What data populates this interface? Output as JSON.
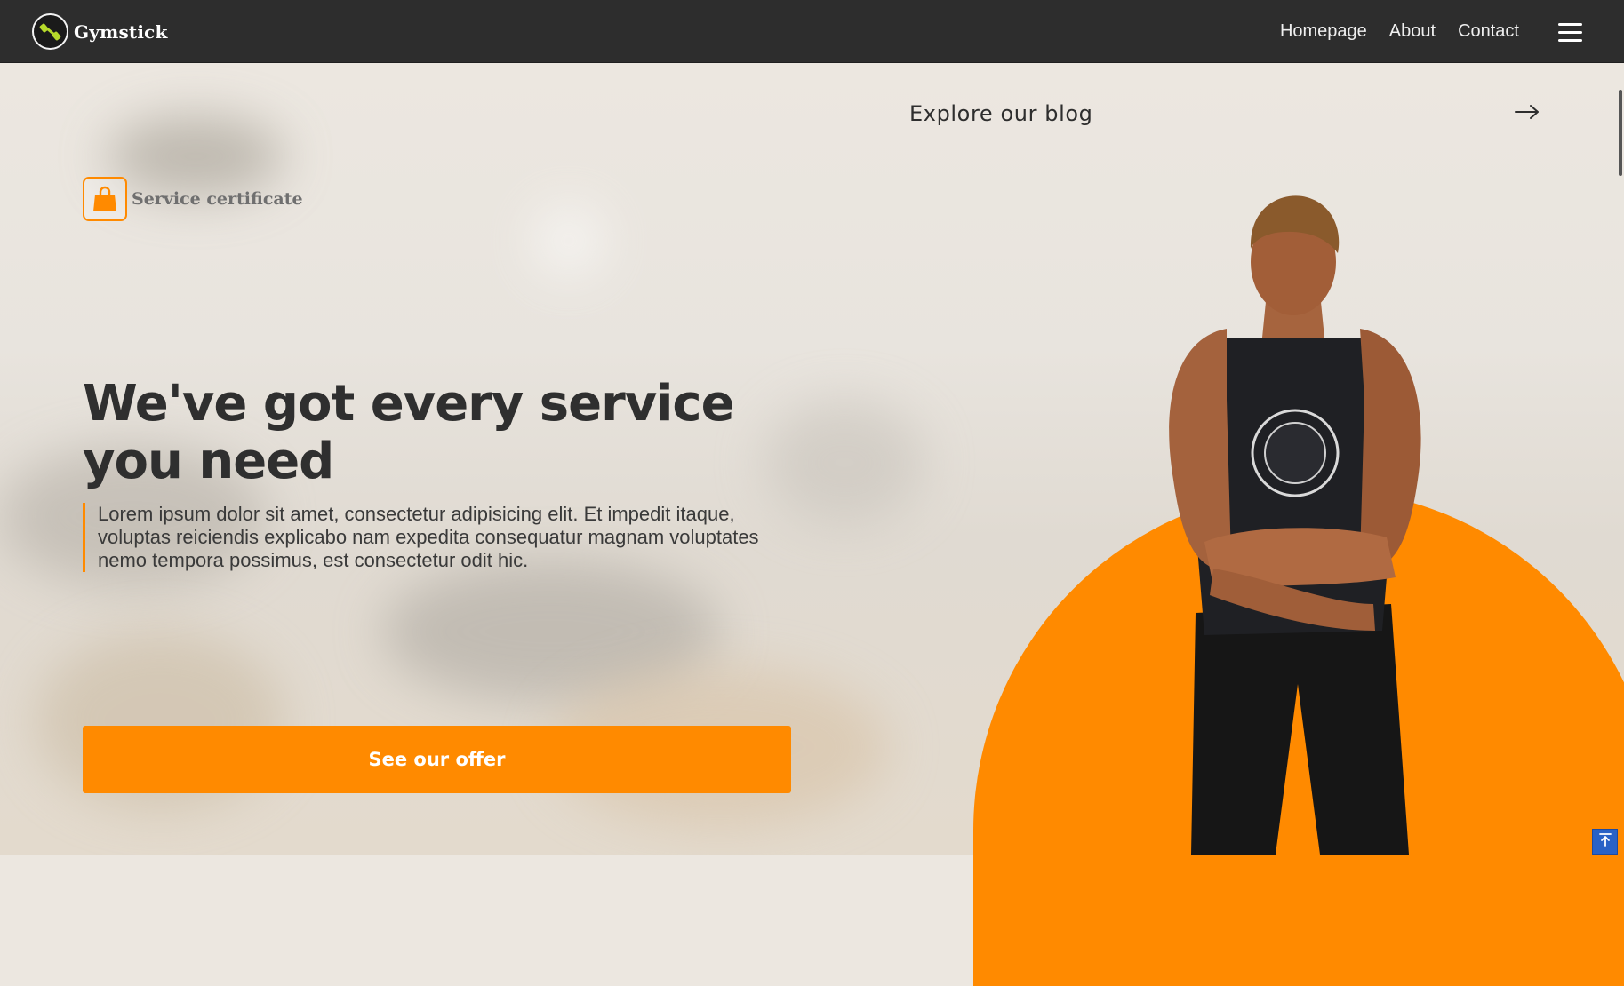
{
  "header": {
    "brand_name": "Gymstick",
    "nav": [
      {
        "label": "Homepage"
      },
      {
        "label": "About"
      },
      {
        "label": "Contact"
      }
    ]
  },
  "hero": {
    "explore_label": "Explore our blog",
    "certificate_label": "Service certificate",
    "headline": "We've got every service you need",
    "lead": "Lorem ipsum dolor sit amet, consectetur adipisicing elit. Et impedit itaque, voluptas reiciendis explicabo nam expedita consequatur magnam voluptates nemo tempora possimus, est consectetur odit hic.",
    "cta_label": "See our offer"
  },
  "colors": {
    "accent": "#ff8a00",
    "header_bg": "#2d2d2d",
    "logo_green": "#b6d92b",
    "back_to_top": "#2962c6"
  },
  "icons": {
    "logo": "dumbbell-icon",
    "explore": "arrow-right-icon",
    "certificate": "shopping-bag-icon",
    "menu": "hamburger-menu-icon",
    "back_to_top": "arrow-up-to-line-icon"
  }
}
